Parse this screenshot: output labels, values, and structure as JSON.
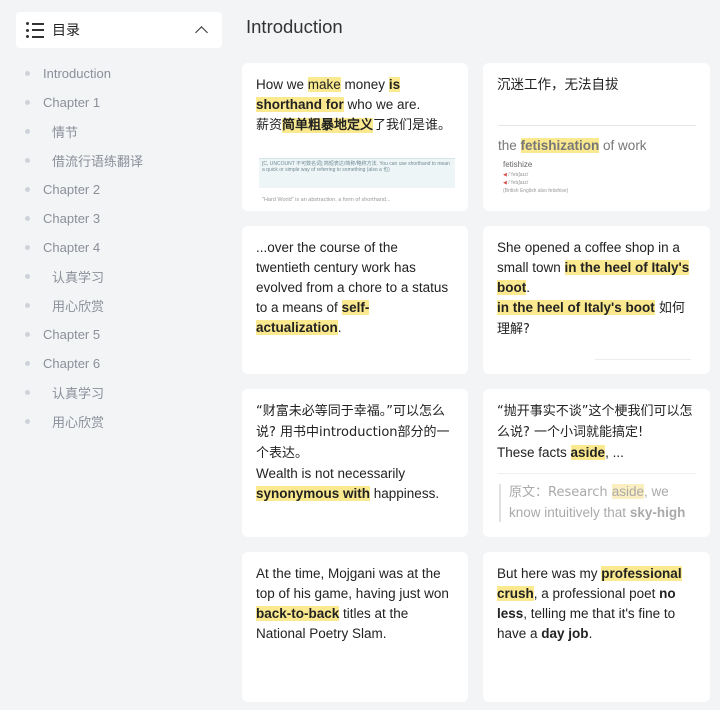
{
  "sidebar": {
    "title": "目录",
    "items": [
      {
        "label": "Introduction"
      },
      {
        "label": "Chapter 1"
      },
      {
        "label": "情节"
      },
      {
        "label": "借流行语练翻译"
      },
      {
        "label": "Chapter 2"
      },
      {
        "label": "Chapter 3"
      },
      {
        "label": "Chapter 4"
      },
      {
        "label": "认真学习"
      },
      {
        "label": "用心欣赏"
      },
      {
        "label": "Chapter 5"
      },
      {
        "label": "Chapter 6"
      },
      {
        "label": "认真学习"
      },
      {
        "label": "用心欣赏"
      }
    ]
  },
  "page": {
    "title": "Introduction"
  },
  "cards": {
    "c1": {
      "p1": "How we ",
      "p2": "make",
      "p3": " money ",
      "p4": "is",
      "p5": "shorthand for",
      "p6": " who we are.",
      "p7": "薪资",
      "p8": "简单粗暴地定义",
      "p9": "了我们是谁。",
      "dict": "[C, UNCOUNT 不可数名词] 简短表达/简称/略称方法. You can use shorthand to mean a quick or simple way of referring to something (also a 也)",
      "foot": "\"Hard World\" is an abstraction, a form of shorthand..."
    },
    "c2": {
      "title": "沉迷工作，无法自拔",
      "p1": "the ",
      "p2": "fetishization",
      "p3": " of work",
      "word": "fetishize",
      "dict_lines": [
        "/ˈfetɪʃaɪz/",
        "/ˈfetɪʃaɪz/",
        "(British English also fetishise)"
      ]
    },
    "c3": {
      "p1": "...over the course of the twentieth century work has evolved from a chore to a status to a means of ",
      "p2": "self-actualization",
      "p3": "."
    },
    "c4": {
      "p1": "She opened a coffee shop in a small town ",
      "p2": "in the heel of Italy's boot",
      "p3": ".",
      "p4": "in the heel of Italy's boot",
      "p5": " 如何理解?"
    },
    "c5": {
      "p1": "“财富未必等同于幸福。”可以怎么说? 用书中introduction部分的一个表达。",
      "p2": "Wealth is not necessarily ",
      "p3": "synonymous with",
      "p4": " happiness."
    },
    "c6": {
      "p1": "“抛开事实不谈”这个梗我们可以怎么说? 一个小词就能搞定!",
      "p2": "These facts ",
      "p3": "aside",
      "p4": ", ...",
      "q1": "原文：Research ",
      "q2": "aside",
      "q3": ", we know intuitively that ",
      "q4": "sky-high"
    },
    "c7": {
      "p1": "At the time, Mojgani was at the top of his game, having just won ",
      "p2": "back-to-back",
      "p3": " titles at the National Poetry Slam."
    },
    "c8": {
      "p1": "But here was my ",
      "p2": "professional crush",
      "p3": ", a professional poet ",
      "p4": "no less",
      "p5": ", telling me that it's fine to have a ",
      "p6": "day job",
      "p7": "."
    }
  },
  "colors": {
    "highlight": "#fbe98f",
    "background": "#f3f4f6",
    "card": "#ffffff"
  }
}
